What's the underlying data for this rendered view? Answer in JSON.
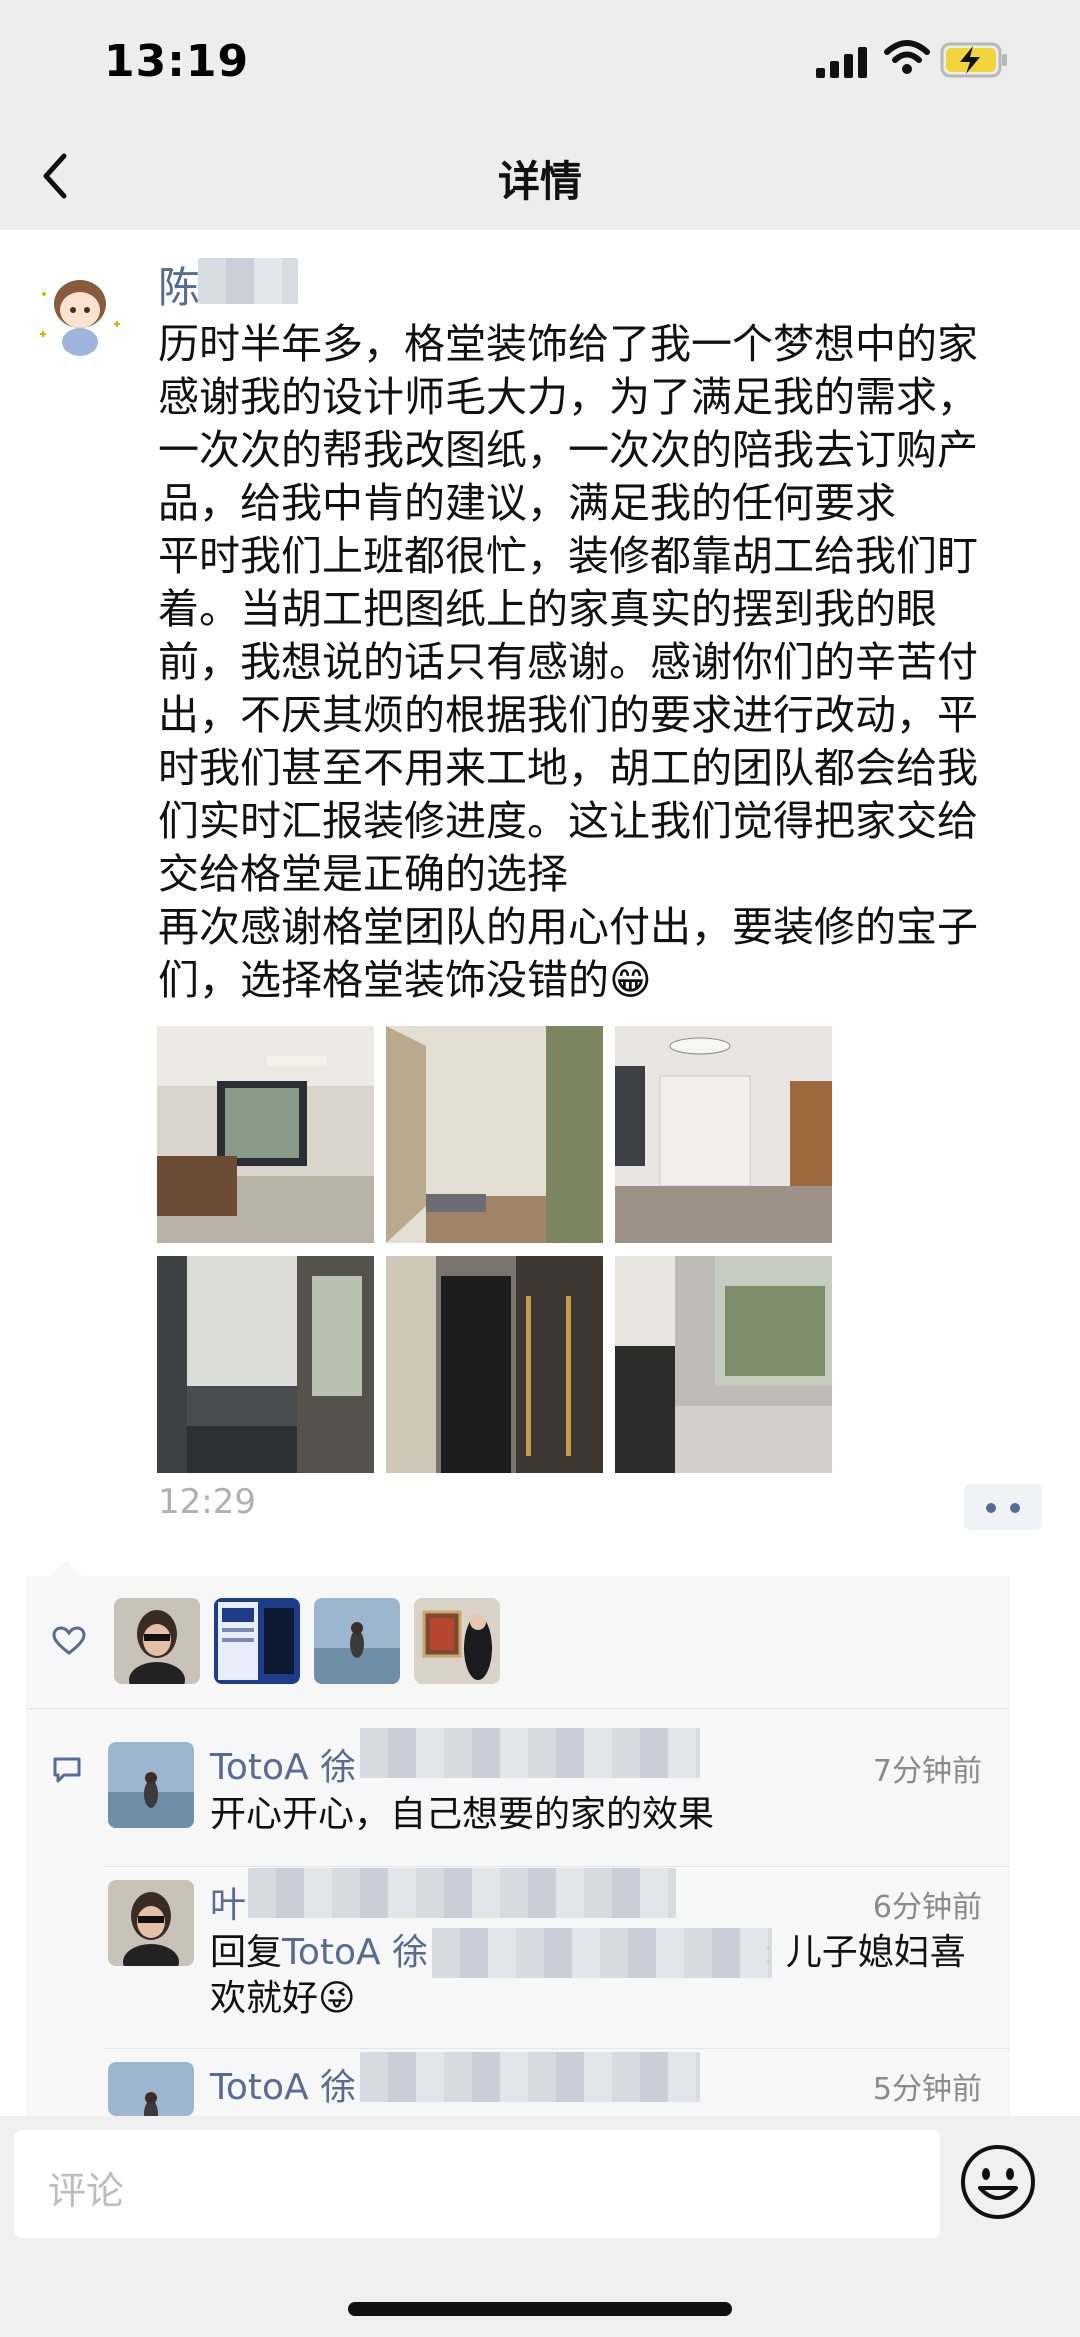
{
  "status_bar": {
    "time": "13:19"
  },
  "nav": {
    "title": "详情"
  },
  "post": {
    "author": "陈",
    "lines": [
      "历时半年多，格堂装饰给了我一个梦想中的家",
      "感谢我的设计师毛大力，为了满足我的需求，",
      "一次次的帮我改图纸，一次次的陪我去订购产",
      "品，给我中肯的建议，满足我的任何要求",
      "平时我们上班都很忙，装修都靠胡工给我们盯",
      "着。当胡工把图纸上的家真实的摆到我的眼",
      "前，我想说的话只有感谢。感谢你们的辛苦付",
      "出，不厌其烦的根据我们的要求进行改动，平",
      "时我们甚至不用来工地，胡工的团队都会给我",
      "们实时汇报装修进度。这让我们觉得把家交给",
      "交给格堂是正确的选择",
      "再次感谢格堂团队的用心付出，要装修的宝子",
      "们，选择格堂装饰没错的😁"
    ],
    "time": "12:29"
  },
  "comments": [
    {
      "name": "TotoA 徐",
      "time": "7分钟前",
      "text": "开心开心，自己想要的家的效果"
    },
    {
      "name": "叶",
      "time": "6分钟前",
      "reply_prefix": "回复",
      "reply_to": "TotoA 徐",
      "text_line1": ": 儿子媳妇喜",
      "text_line2": "欢就好😜"
    },
    {
      "name": "TotoA 徐",
      "time": "5分钟前"
    }
  ],
  "input": {
    "placeholder": "评论"
  },
  "colors": {
    "link": "#576b95",
    "panel": "#f7f7f7",
    "nav_bg": "#ededed"
  }
}
